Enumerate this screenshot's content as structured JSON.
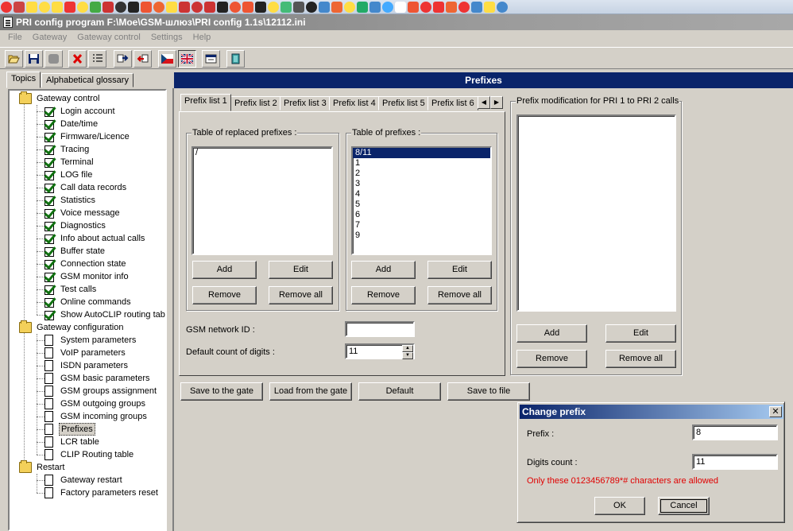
{
  "window": {
    "title": "PRI config program F:\\Мое\\GSM-шлюз\\PRI config 1.1s\\12112.ini"
  },
  "menu": [
    "File",
    "Gateway",
    "Gateway control",
    "Settings",
    "Help"
  ],
  "left_tabs": [
    "Topics",
    "Alphabetical glossary"
  ],
  "tree": {
    "gateway_control": {
      "label": "Gateway control",
      "items": [
        "Login account",
        "Date/time",
        "Firmware/Licence",
        "Tracing",
        "Terminal",
        "LOG file",
        "Call data records",
        "Statistics",
        "Voice message",
        "Diagnostics",
        "Info about actual calls",
        "Buffer state",
        "Connection state",
        "GSM monitor info",
        "Test calls",
        "Online commands",
        "Show AutoCLIP routing table"
      ]
    },
    "gateway_configuration": {
      "label": "Gateway configuration",
      "items": [
        "System parameters",
        "VoIP parameters",
        "ISDN parameters",
        "GSM basic parameters",
        "GSM groups assignment",
        "GSM outgoing groups",
        "GSM incoming groups",
        "Prefixes",
        "LCR table",
        "CLIP Routing table"
      ],
      "selected": "Prefixes"
    },
    "restart": {
      "label": "Restart",
      "items": [
        "Gateway restart",
        "Factory parameters reset"
      ]
    }
  },
  "panel_title": "Prefixes",
  "prefix_tabs": [
    "Prefix list 1",
    "Prefix list 2",
    "Prefix list 3",
    "Prefix list 4",
    "Prefix list 5",
    "Prefix list 6"
  ],
  "replaced": {
    "title": "Table of replaced prefixes :",
    "items": [
      "/"
    ],
    "add": "Add",
    "edit": "Edit",
    "remove": "Remove",
    "remove_all": "Remove all"
  },
  "prefixes": {
    "title": "Table of  prefixes :",
    "items": [
      "8/11",
      "1",
      "2",
      "3",
      "4",
      "5",
      "6",
      "7",
      "9"
    ],
    "selected": "8/11",
    "add": "Add",
    "edit": "Edit",
    "remove": "Remove",
    "remove_all": "Remove all"
  },
  "gsm_network_id": {
    "label": "GSM network ID :",
    "value": ""
  },
  "default_digits": {
    "label": "Default count of digits :",
    "value": "11"
  },
  "modification": {
    "title": "Prefix modification for PRI 1 to PRI 2 calls",
    "add": "Add",
    "edit": "Edit",
    "remove": "Remove",
    "remove_all": "Remove all"
  },
  "bottom_buttons": {
    "save_gate": "Save to the gate",
    "load_gate": "Load from the gate",
    "default": "Default",
    "save_file": "Save to file"
  },
  "dialog": {
    "title": "Change prefix",
    "close": "✕",
    "prefix_label": "Prefix :",
    "prefix_value": "8",
    "digits_label": "Digits count :",
    "digits_value": "11",
    "warning": "Only these 0123456789*# characters are allowed",
    "ok": "OK",
    "cancel": "Cancel"
  }
}
